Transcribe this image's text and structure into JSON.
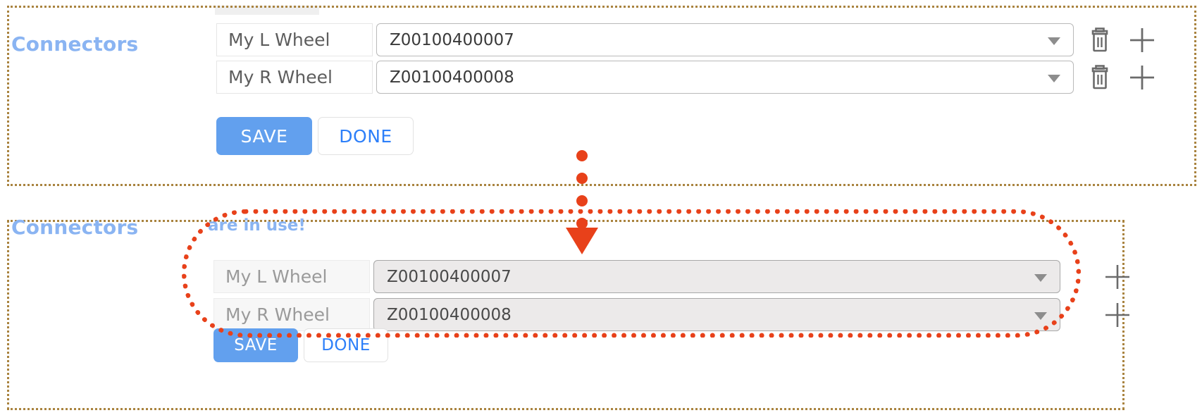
{
  "panels": {
    "top": {
      "title": "Connectors",
      "rows": [
        {
          "label": "My L Wheel",
          "value": "Z00100400007",
          "delete_icon": "trash-icon",
          "add_icon": "plus-icon"
        },
        {
          "label": "My R Wheel",
          "value": "Z00100400008",
          "delete_icon": "trash-icon",
          "add_icon": "plus-icon"
        }
      ],
      "buttons": {
        "save": "SAVE",
        "done": "DONE"
      }
    },
    "bottom": {
      "title": "Connectors",
      "status_message": "are in use!",
      "rows": [
        {
          "label": "My L Wheel",
          "value": "Z00100400007",
          "add_icon": "plus-icon"
        },
        {
          "label": "My R Wheel",
          "value": "Z00100400008",
          "add_icon": "plus-icon"
        }
      ],
      "buttons": {
        "save": "SAVE",
        "done": "DONE"
      }
    }
  },
  "annotations": {
    "highlight_color": "#e8411a",
    "panel_border_color": "#a9833f",
    "arrow_icon": "down-arrow-icon",
    "highlight_shape": "rounded-rectangle"
  },
  "colors": {
    "title_blue": "#8ab4f2",
    "save_button": "#62a0ee",
    "done_text": "#2d7ff9"
  }
}
